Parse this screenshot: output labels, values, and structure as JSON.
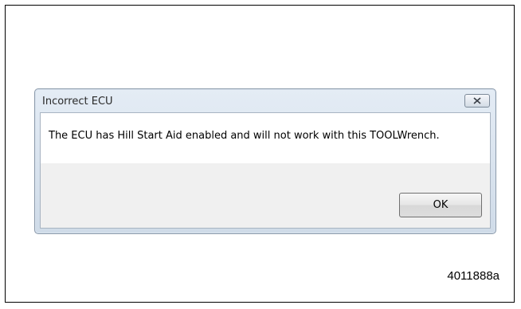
{
  "dialog": {
    "title": "Incorrect ECU",
    "message": "The ECU has Hill Start Aid enabled and will not work with this TOOLWrench.",
    "ok_label": "OK",
    "close_icon": "close-icon"
  },
  "figure_id": "4011888a"
}
